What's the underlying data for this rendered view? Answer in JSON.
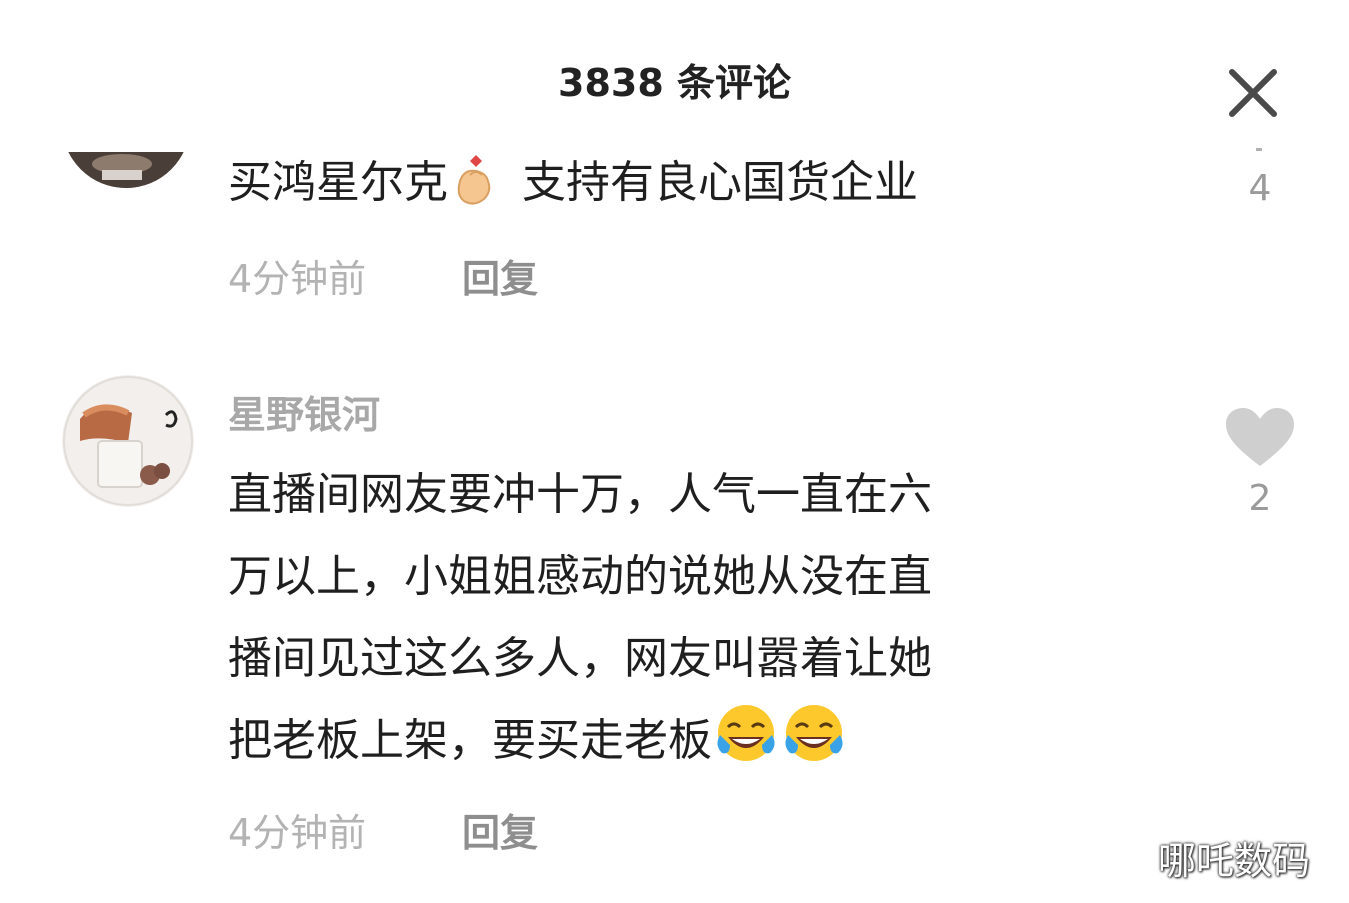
{
  "header": {
    "title": "3838 条评论"
  },
  "icons": {
    "close": "close-icon",
    "like": "heart-icon",
    "emoji_finger_heart": "finger-heart-emoji",
    "emoji_laugh_cry": "laughing-crying-emoji"
  },
  "colors": {
    "like_gray": "#cfcfcf",
    "meta_gray": "#b3b3b3",
    "reply_gray": "#8e8e8e"
  },
  "comments": [
    {
      "text_before_emoji": "买鸿星尔克",
      "text_after_emoji": "支持有良心国货企业",
      "time": "4分钟前",
      "reply_label": "回复",
      "like_count": "4"
    },
    {
      "username": "星野银河",
      "lines": [
        "直播间网友要冲十万，人气一直在六",
        "万以上，小姐姐感动的说她从没在直",
        "播间见过这么多人，网友叫嚣着让她",
        "把老板上架，要买走老板"
      ],
      "time": "4分钟前",
      "reply_label": "回复",
      "like_count": "2"
    }
  ],
  "watermark": "哪吒数码"
}
